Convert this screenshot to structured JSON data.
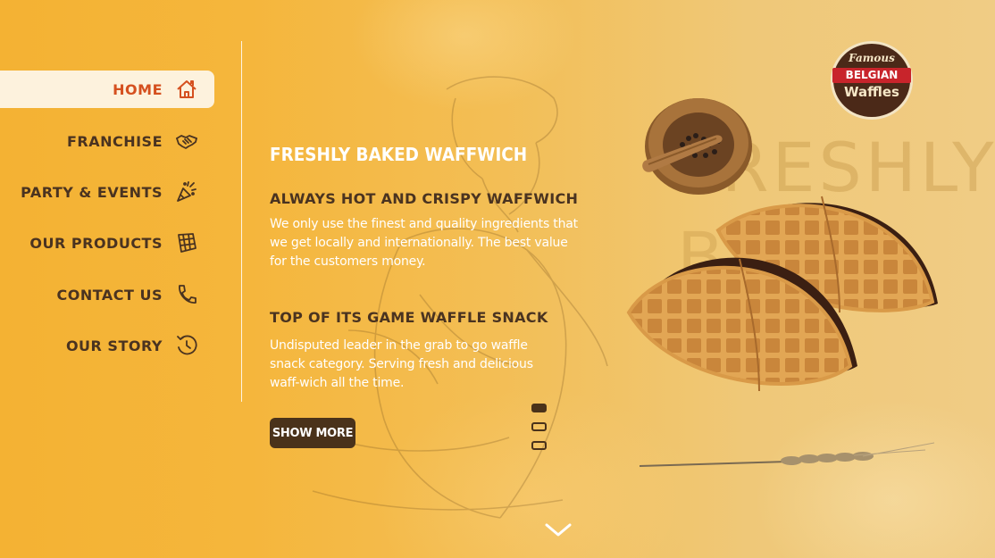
{
  "nav": {
    "items": [
      {
        "label": "HOME",
        "icon": "home-icon",
        "active": true
      },
      {
        "label": "FRANCHISE",
        "icon": "handshake-icon",
        "active": false
      },
      {
        "label": "PARTY & EVENTS",
        "icon": "party-popper-icon",
        "active": false
      },
      {
        "label": "OUR PRODUCTS",
        "icon": "waffle-icon",
        "active": false
      },
      {
        "label": "CONTACT US",
        "icon": "phone-icon",
        "active": false
      },
      {
        "label": "OUR STORY",
        "icon": "history-icon",
        "active": false
      }
    ]
  },
  "hero": {
    "headline": "FRESHLY BAKED WAFFWICH",
    "sections": [
      {
        "title": "ALWAYS HOT AND CRISPY WAFFWICH",
        "body": "We only use the finest and quality ingredients that we get locally and internationally. The best value for the customers money."
      },
      {
        "title": "TOP OF ITS GAME WAFFLE SNACK",
        "body": "Undisputed leader in the grab to go waffle snack category. Serving fresh and delicious waff-wich all the time."
      }
    ],
    "cta_label": "SHOW MORE",
    "background_word_1": "FRESHLY",
    "background_word_2": "B"
  },
  "slider": {
    "total": 3,
    "active_index": 0
  },
  "logo": {
    "line1": "Famous",
    "line2": "BELGIAN",
    "line3": "Waffles"
  },
  "colors": {
    "background": "#f4b233",
    "accent_active": "#d5501f",
    "dark_brown": "#4a321a",
    "active_nav_bg": "#fdf2dd",
    "logo_red": "#c8242b"
  }
}
